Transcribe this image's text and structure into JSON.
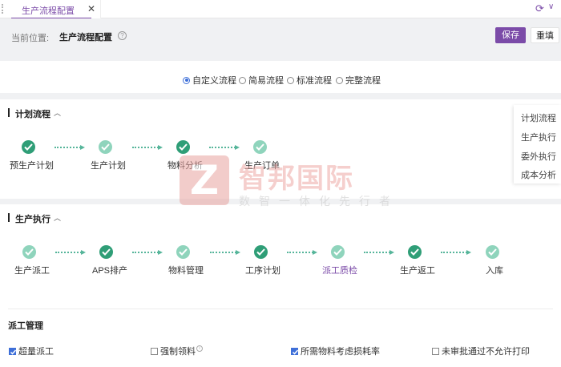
{
  "tabs": [
    {
      "label": "生产流程配置"
    }
  ],
  "header": {
    "breadcrumb_label": "当前位置:",
    "page_title": "生产流程配置",
    "save_label": "保存",
    "reset_label": "重填"
  },
  "mode_options": [
    {
      "label": "自定义流程",
      "checked": true
    },
    {
      "label": "简易流程",
      "checked": false
    },
    {
      "label": "标准流程",
      "checked": false
    },
    {
      "label": "完整流程",
      "checked": false
    }
  ],
  "plan_section": {
    "title": "计划流程",
    "steps": [
      {
        "label": "预生产计划",
        "style": "dark"
      },
      {
        "label": "生产计划",
        "style": "light"
      },
      {
        "label": "物料分析",
        "style": "dark"
      },
      {
        "label": "生产订单",
        "style": "light"
      }
    ]
  },
  "exec_section": {
    "title": "生产执行",
    "steps": [
      {
        "label": "生产派工",
        "style": "light"
      },
      {
        "label": "APS排产",
        "style": "dark"
      },
      {
        "label": "物料管理",
        "style": "light"
      },
      {
        "label": "工序计划",
        "style": "dark"
      },
      {
        "label": "派工质检",
        "style": "light",
        "active": true
      },
      {
        "label": "生产返工",
        "style": "dark"
      },
      {
        "label": "入库",
        "style": "light"
      }
    ]
  },
  "side_nav": [
    "计划流程",
    "生产执行",
    "委外执行",
    "成本分析"
  ],
  "dispatch": {
    "title": "派工管理",
    "options": [
      {
        "label": "超量派工",
        "checked": true
      },
      {
        "label": "强制领料",
        "checked": false,
        "info": true
      },
      {
        "label": "所需物料考虑损耗率",
        "checked": true
      },
      {
        "label": "未审批通过不允许打印",
        "checked": false
      }
    ]
  },
  "watermark": {
    "logo_letter": "Z",
    "name": "智邦国际",
    "slogan": "数智一体化先行者"
  },
  "colors": {
    "accent": "#7b4ba8",
    "node_dark": "#2f9e77",
    "node_light": "#8fd4bc",
    "checkbox": "#3e6fd8"
  }
}
